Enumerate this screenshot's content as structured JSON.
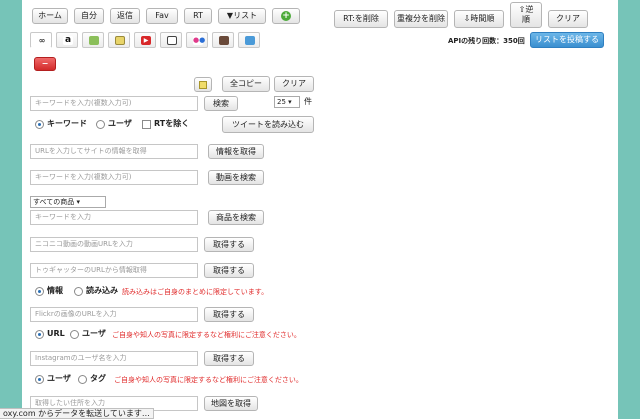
{
  "nav": {
    "home": "ホーム",
    "mine": "自分",
    "mentions": "返信",
    "fav": "Fav",
    "rt": "RT",
    "list": "▼リスト",
    "add": "+"
  },
  "tabs": [
    {
      "icon": "link-icon"
    },
    {
      "icon": "amazon-icon"
    },
    {
      "icon": "nicovideo-icon"
    },
    {
      "icon": "image-icon"
    },
    {
      "icon": "youtube-icon"
    },
    {
      "icon": "tv-icon"
    },
    {
      "icon": "flickr-icon"
    },
    {
      "icon": "instagram-icon"
    },
    {
      "icon": "map-icon"
    }
  ],
  "toolbar_right": {
    "rt_delete": "RT:を削除",
    "dedupe": "重複分を削除",
    "time_sort": "⇩時間順",
    "reverse_line1": "⇧逆",
    "reverse_line2": "順",
    "clear": "クリア",
    "api_remaining": "APIの残り回数：350回",
    "post_list": "リストを投稿する"
  },
  "remove": "−",
  "actions": {
    "copy_all": "全コピー",
    "clear": "クリア"
  },
  "keyword": {
    "placeholder": "キーワードを入力(複数入力可)",
    "search": "検索",
    "count": "25",
    "count_unit": "件",
    "opt_keyword": "キーワード",
    "opt_user": "ユーザ",
    "exclude_rt": "RTを除く",
    "load_tweets": "ツイートを読み込む"
  },
  "url": {
    "placeholder": "URLを入力してサイトの情報を取得",
    "button": "情報を取得"
  },
  "video": {
    "placeholder": "キーワードを入力(複数入力可)",
    "button": "動画を検索"
  },
  "product": {
    "category": "すべての商品",
    "placeholder": "キーワードを入力",
    "button": "商品を検索"
  },
  "nico": {
    "placeholder": "ニコニコ動画の動画URLを入力",
    "button": "取得する"
  },
  "togetter": {
    "placeholder": "トゥギャッターのURLから情報取得",
    "button": "取得する",
    "opt_info": "情報",
    "opt_load": "読み込み",
    "note": "読み込みはご自身のまとめに限定しています。"
  },
  "flickr": {
    "placeholder": "Flickrの画像のURLを入力",
    "button": "取得する",
    "opt_url": "URL",
    "opt_user": "ユーザ",
    "note": "ご自身や知人の写真に限定するなど権利にご注意ください。"
  },
  "instagram": {
    "placeholder": "Instagramのユーザ名を入力",
    "button": "取得する",
    "opt_user": "ユーザ",
    "opt_tag": "タグ",
    "note": "ご自身や知人の写真に限定するなど権利にご注意ください。"
  },
  "map": {
    "placeholder": "取得したい住所を入力",
    "button": "地図を取得"
  },
  "status": "oxy.com からデータを転送しています…",
  "colors": {
    "background": "#76c4b8",
    "primary_button": "#3a8fd0",
    "danger_button": "#d22a2a",
    "warning_text": "#e02a2a"
  }
}
